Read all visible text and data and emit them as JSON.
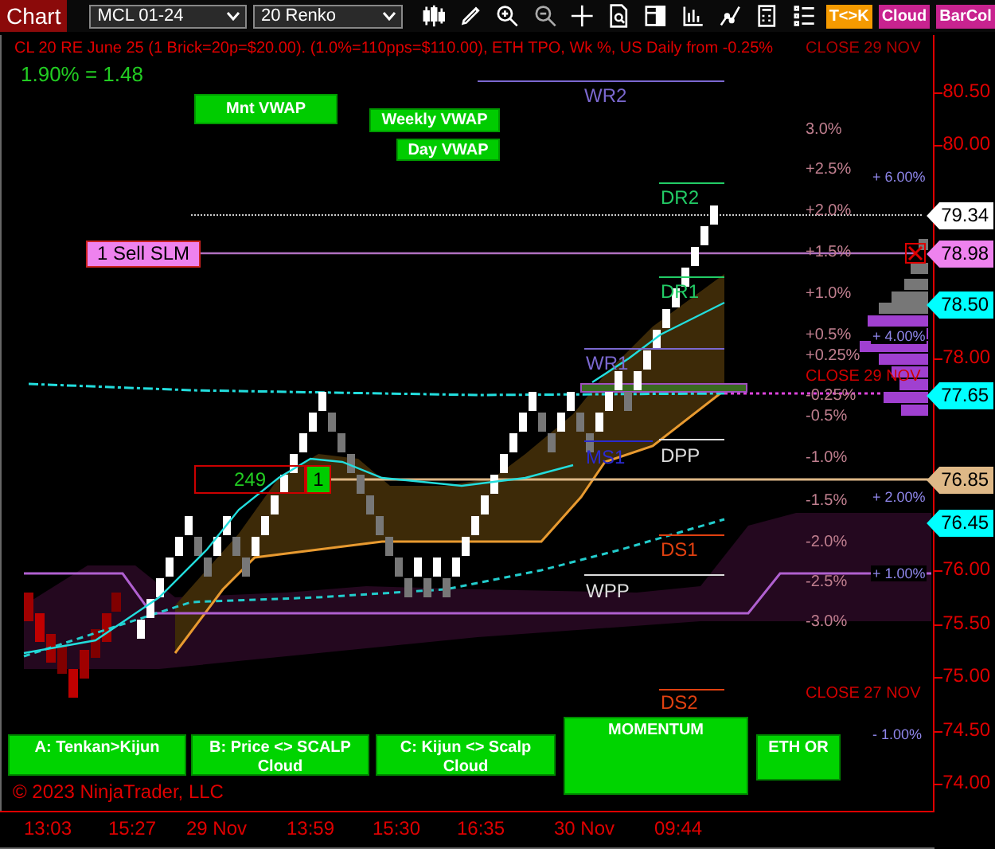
{
  "toolbar": {
    "title": "Chart",
    "instrument": "MCL 01-24",
    "bar_type": "20 Renko",
    "toggles": [
      {
        "label": "T<>K",
        "color": "#f59a00"
      },
      {
        "label": "Cloud",
        "color": "#c8238f"
      },
      {
        "label": "BarCol",
        "color": "#c8238f"
      }
    ]
  },
  "chart": {
    "header": "CL 20 RE June 25 (1 Brick=20p=$20.00). (1.0%=110pps=$110.00), ETH TPO, Wk %, US Daily from -0.25%",
    "header_overlap": "CLOSE 29 NOV",
    "summary": "1.90% = 1.48",
    "vwap_buttons": [
      "Mnt VWAP",
      "Weekly VWAP",
      "Day VWAP"
    ],
    "pivot_labels": [
      {
        "text": "WR2",
        "color": "#7b68d0"
      },
      {
        "text": "DR2",
        "color": "#22cc66"
      },
      {
        "text": "DR1",
        "color": "#22cc66"
      },
      {
        "text": "WR1",
        "color": "#7b68d0"
      },
      {
        "text": "MS1",
        "color": "#2a2ad0"
      },
      {
        "text": "DPP",
        "color": "#dddddd"
      },
      {
        "text": "DS1",
        "color": "#e04010"
      },
      {
        "text": "WPP",
        "color": "#dddddd"
      },
      {
        "text": "DS2",
        "color": "#e04010"
      }
    ],
    "percent_labels": [
      "3.0%",
      "+2.5%",
      "+2.0%",
      "+1.5%",
      "+1.0%",
      "+0.5%",
      "+0.25%",
      "-0.25%",
      "-0.5%",
      "-1.0%",
      "-1.5%",
      "-2.0%",
      "-2.5%",
      "-3.0%"
    ],
    "close_labels": [
      "CLOSE 29 NOV",
      "CLOSE 27 NOV"
    ],
    "weekly_labels": [
      "+ 6.00%",
      "+ 4.00%",
      "+ 2.00%",
      "+ 1.00%",
      "- 1.00%"
    ],
    "order": {
      "label": "1 Sell SLM"
    },
    "position": {
      "quantity": "249",
      "badge": "1"
    },
    "signal_buttons": [
      "A: Tenkan>Kijun",
      "B: Price <> SCALP Cloud",
      "C: Kijun <> Scalp Cloud",
      "MOMENTUM",
      "ETH OR"
    ],
    "copyright": "© 2023 NinjaTrader, LLC"
  },
  "price_axis": {
    "labels": [
      "80.50",
      "80.00",
      "78.00",
      "76.00",
      "75.50",
      "75.00",
      "74.50",
      "74.00"
    ],
    "markers": [
      {
        "text": "79.34",
        "color": "#ffffff"
      },
      {
        "text": "78.98",
        "color": "#ee82ee"
      },
      {
        "text": "78.50",
        "color": "#00ffff"
      },
      {
        "text": "77.65",
        "color": "#00ffff"
      },
      {
        "text": "76.85",
        "color": "#deb887"
      },
      {
        "text": "76.45",
        "color": "#00ffff"
      }
    ]
  },
  "time_axis": [
    "13:03",
    "15:27",
    "29 Nov",
    "13:59",
    "15:30",
    "16:35",
    "30 Nov",
    "09:44"
  ]
}
